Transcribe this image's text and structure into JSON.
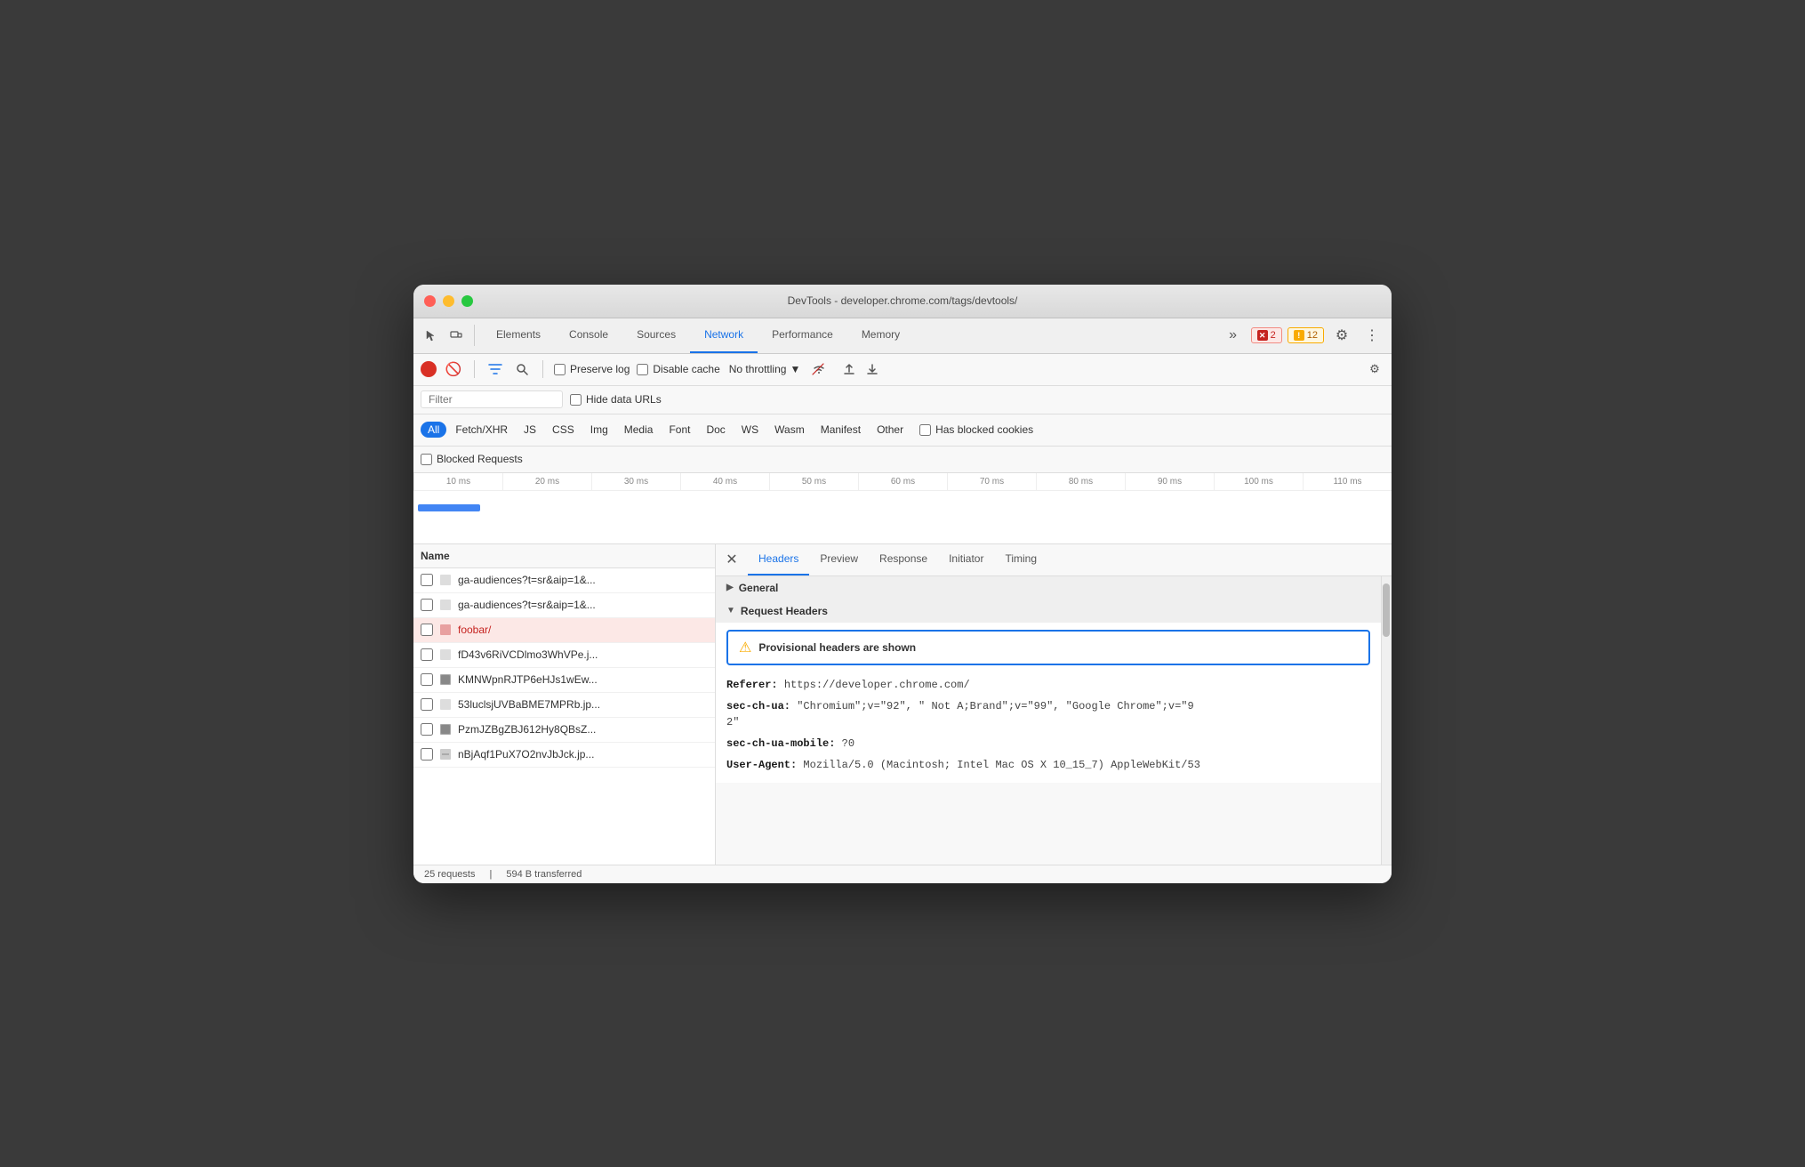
{
  "window": {
    "title": "DevTools - developer.chrome.com/tags/devtools/"
  },
  "titlebar_buttons": {
    "close": "●",
    "min": "●",
    "max": "●"
  },
  "devtools": {
    "tabs": [
      {
        "label": "Elements",
        "active": false
      },
      {
        "label": "Console",
        "active": false
      },
      {
        "label": "Sources",
        "active": false
      },
      {
        "label": "Network",
        "active": true
      },
      {
        "label": "Performance",
        "active": false
      },
      {
        "label": "Memory",
        "active": false
      }
    ],
    "overflow_icon": "»",
    "error_count": "2",
    "warning_count": "12",
    "settings_icon": "⚙",
    "more_icon": "⋮"
  },
  "toolbar": {
    "record_title": "Record",
    "clear_icon": "🚫",
    "filter_icon": "⚑",
    "search_icon": "🔍",
    "preserve_log_label": "Preserve log",
    "disable_cache_label": "Disable cache",
    "throttling_label": "No throttling",
    "throttling_arrow": "▼",
    "wifi_icon": "⇆",
    "upload_icon": "↑",
    "download_icon": "↓",
    "settings_icon": "⚙"
  },
  "filter": {
    "placeholder": "Filter",
    "hide_data_urls_label": "Hide data URLs"
  },
  "type_filters": [
    {
      "label": "All",
      "active": true
    },
    {
      "label": "Fetch/XHR",
      "active": false
    },
    {
      "label": "JS",
      "active": false
    },
    {
      "label": "CSS",
      "active": false
    },
    {
      "label": "Img",
      "active": false
    },
    {
      "label": "Media",
      "active": false
    },
    {
      "label": "Font",
      "active": false
    },
    {
      "label": "Doc",
      "active": false
    },
    {
      "label": "WS",
      "active": false
    },
    {
      "label": "Wasm",
      "active": false
    },
    {
      "label": "Manifest",
      "active": false
    },
    {
      "label": "Other",
      "active": false
    }
  ],
  "has_blocked_cookies_label": "Has blocked cookies",
  "blocked_requests_label": "Blocked Requests",
  "timeline": {
    "ticks": [
      "10 ms",
      "20 ms",
      "30 ms",
      "40 ms",
      "50 ms",
      "60 ms",
      "70 ms",
      "80 ms",
      "90 ms",
      "100 ms",
      "110 ms"
    ]
  },
  "requests": {
    "column_name": "Name",
    "items": [
      {
        "name": "ga-audiences?t=sr&aip=1&...",
        "type": "img",
        "selected": false,
        "error": false
      },
      {
        "name": "ga-audiences?t=sr&aip=1&...",
        "type": "img",
        "selected": false,
        "error": false
      },
      {
        "name": "foobar/",
        "type": "doc",
        "selected": true,
        "error": true
      },
      {
        "name": "fD43v6RiVCDlmo3WhVPe.j...",
        "type": "js",
        "selected": false,
        "error": false
      },
      {
        "name": "KMNWpnRJTP6eHJs1wEw...",
        "type": "img",
        "selected": false,
        "error": false
      },
      {
        "name": "53luclsjUVBaBME7MPRb.jp...",
        "type": "img",
        "selected": false,
        "error": false
      },
      {
        "name": "PzmJZBgZBJ612Hy8QBsZ...",
        "type": "img",
        "selected": false,
        "error": false
      },
      {
        "name": "nBjAqf1PuX7O2nvJbJck.jp...",
        "type": "img",
        "selected": false,
        "error": false
      }
    ]
  },
  "details": {
    "tabs": [
      {
        "label": "Headers",
        "active": true
      },
      {
        "label": "Preview",
        "active": false
      },
      {
        "label": "Response",
        "active": false
      },
      {
        "label": "Initiator",
        "active": false
      },
      {
        "label": "Timing",
        "active": false
      }
    ],
    "general_section": "General",
    "request_headers_section": "Request Headers",
    "provisional_warning": "Provisional headers are shown",
    "headers": [
      {
        "key": "Referer:",
        "value": "https://developer.chrome.com/"
      },
      {
        "key": "sec-ch-ua:",
        "value": "\"Chromium\";v=\"92\", \" Not A;Brand\";v=\"99\", \"Google Chrome\";v=\"92\""
      },
      {
        "key": "sec-ch-ua-mobile:",
        "value": "?0"
      },
      {
        "key": "User-Agent:",
        "value": "Mozilla/5.0 (Macintosh; Intel Mac OS X 10_15_7) AppleWebKit/53"
      }
    ]
  },
  "status_bar": {
    "requests_count": "25 requests",
    "transferred": "594 B transferred"
  }
}
